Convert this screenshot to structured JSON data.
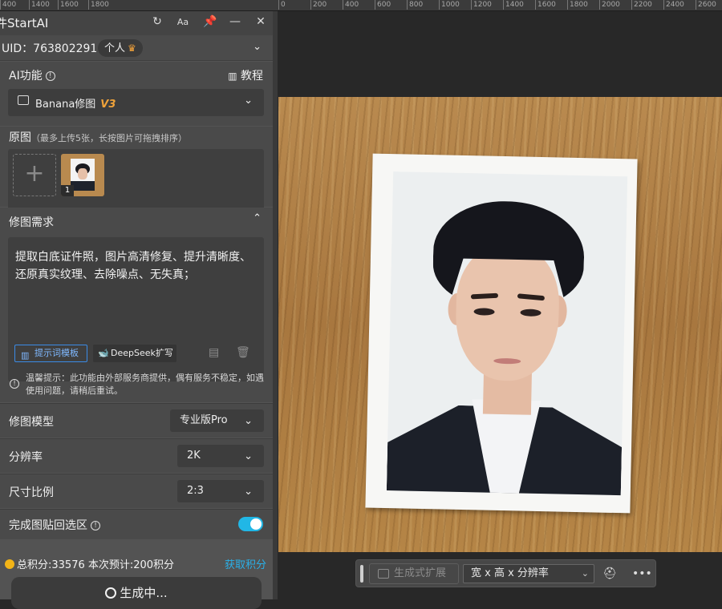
{
  "ruler": {
    "ticks": [
      "400",
      "1400",
      "1600",
      "1800",
      "1200",
      "1000",
      "800",
      "600",
      "400",
      "200",
      "0",
      "200",
      "400",
      "600",
      "800",
      "1000",
      "1200",
      "1400",
      "1600",
      "1800",
      "2000",
      "2200",
      "2400",
      "2600"
    ]
  },
  "panel": {
    "title": "件StartAI",
    "font_icon": "Aa",
    "uid": "UID：763802291",
    "plan_badge": "个人",
    "ai_section_label": "AI功能",
    "tutorial_label": "教程",
    "feature_select": "Banana修图",
    "feature_version": "V3",
    "source_label": "原图",
    "source_hint": "（最多上传5张，长按图片可拖拽排序）",
    "thumb_index": "1",
    "edit_req_label": "修图需求",
    "prompt_text": "提取白底证件照，图片高清修复、提升清晰度、还原真实纹理、去除噪点、无失真；",
    "template_btn": "提示词模板",
    "deepseek_btn": "DeepSeek扩写",
    "tip_text": "温馨提示：此功能由外部服务商提供，偶有服务不稳定，如遇使用问题，请稍后重试。",
    "model_label": "修图模型",
    "model_value": "专业版Pro",
    "resolution_label": "分辨率",
    "resolution_value": "2K",
    "ratio_label": "尺寸比例",
    "ratio_value": "2:3",
    "paste_back_label": "完成图贴回选区",
    "paste_back_on": true,
    "credits_text": "总积分:33576  本次预计:200积分",
    "get_credits": "获取积分",
    "generate_btn": "生成中..."
  },
  "bottom_toolbar": {
    "generative_expand": "生成式扩展",
    "size_select": "宽 x 高 x 分辨率"
  },
  "colors": {
    "accent_blue": "#21b7e6",
    "version_orange": "#f0a33a",
    "panel_bg": "#535353",
    "canvas_bg": "#282828"
  }
}
